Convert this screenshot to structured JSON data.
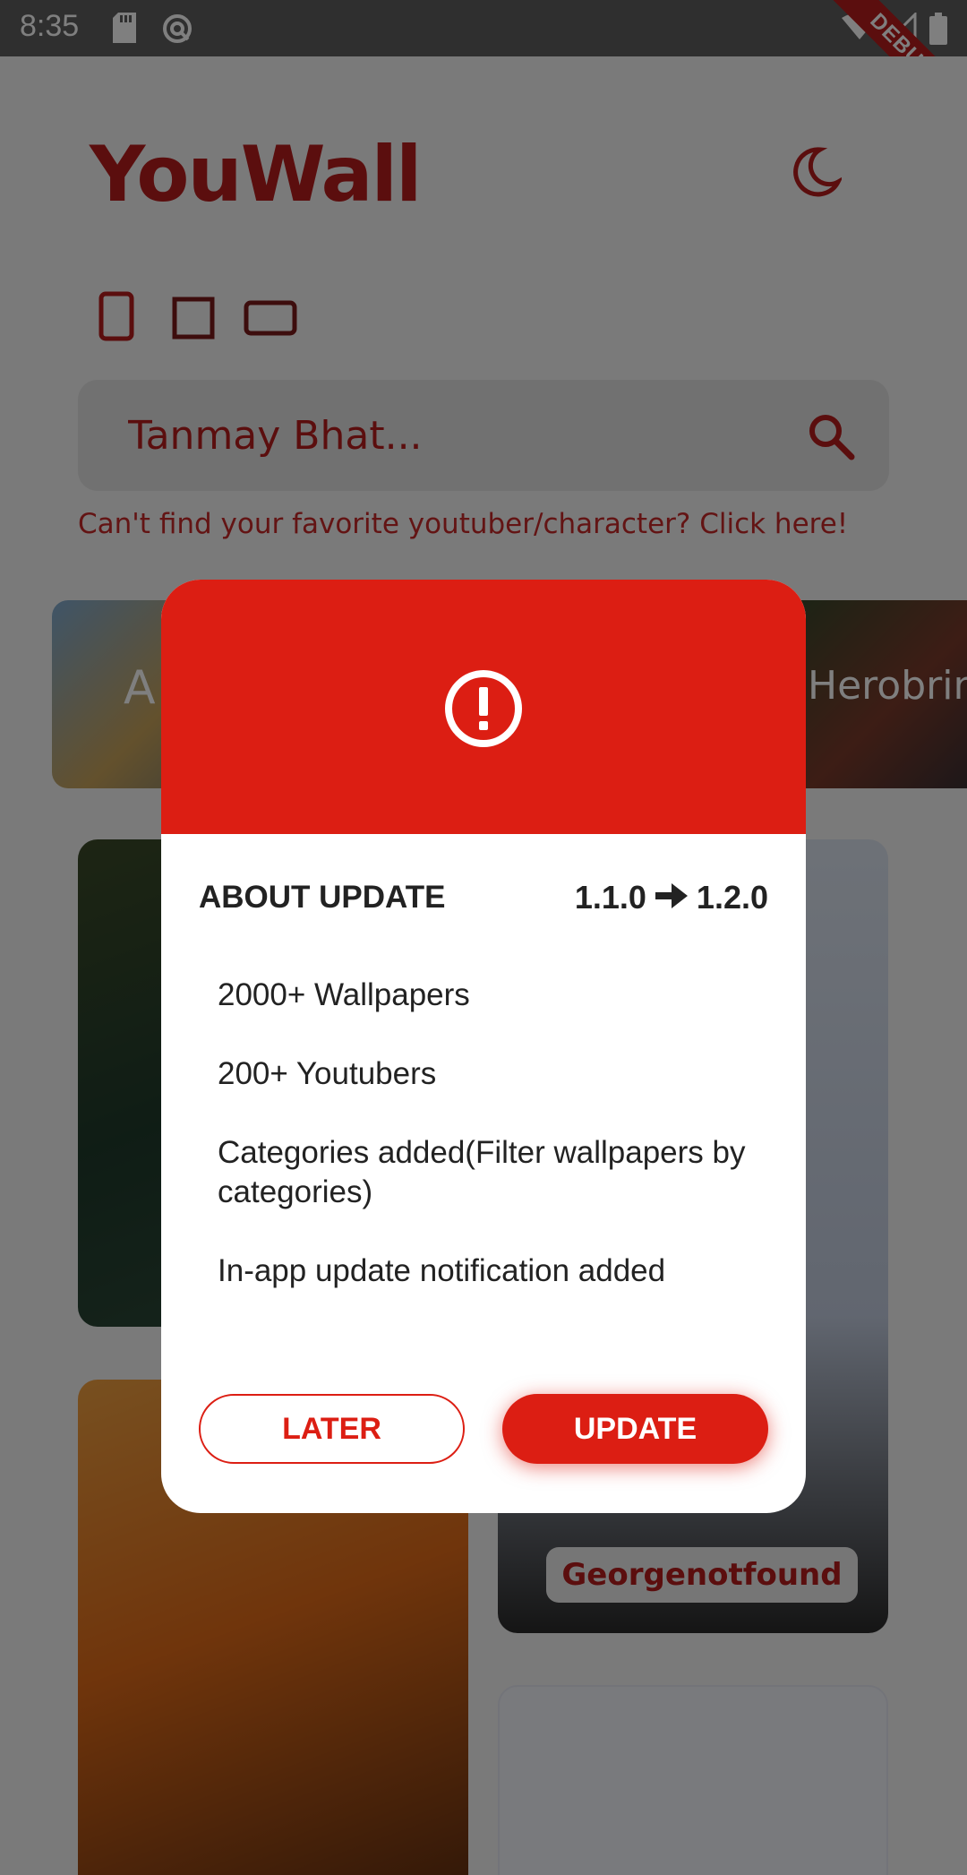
{
  "status_bar": {
    "time": "8:35",
    "debug_label": "DEBUG"
  },
  "app": {
    "title": "YouWall",
    "search": {
      "placeholder": "Tanmay Bhat..."
    },
    "help_link": "Can't find your favorite youtuber/character? Click here!",
    "chips": [
      {
        "label": "A"
      },
      {
        "label": "Herobrine"
      }
    ],
    "cards": [
      {
        "label": "Georgenotfound"
      }
    ]
  },
  "dialog": {
    "title": "ABOUT UPDATE",
    "version_from": "1.1.0",
    "version_to": "1.2.0",
    "notes": [
      "2000+ Wallpapers",
      "200+ Youtubers",
      "Categories added(Filter wallpapers by categories)",
      "In-app update notification added"
    ],
    "later_label": "LATER",
    "update_label": "UPDATE"
  },
  "colors": {
    "accent": "#dc1e13",
    "brand": "#b71c1c"
  }
}
